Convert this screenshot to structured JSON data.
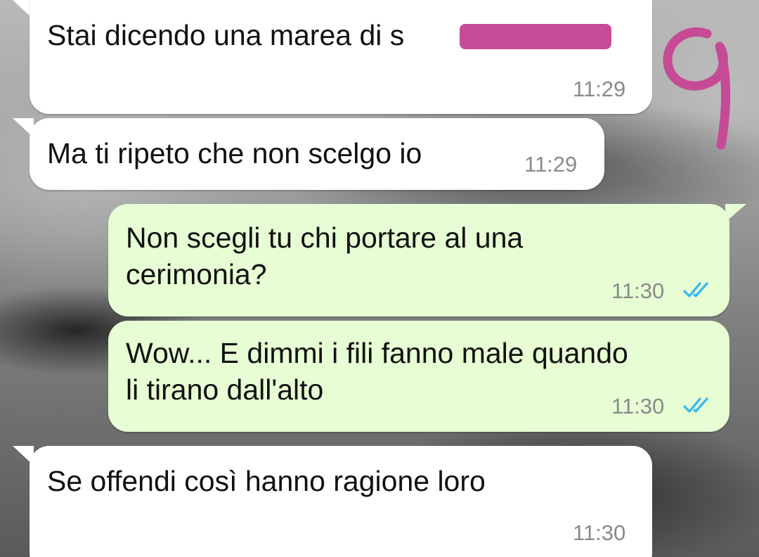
{
  "chat": {
    "messages": [
      {
        "direction": "incoming",
        "text": "Stai dicendo una marea di s",
        "time": "11:29",
        "redacted": true
      },
      {
        "direction": "incoming",
        "text": "Ma ti ripeto che non scelgo io",
        "time": "11:29"
      },
      {
        "direction": "outgoing",
        "text": "Non scegli tu chi portare al una\ncerimonia?",
        "time": "11:30",
        "status": "read"
      },
      {
        "direction": "outgoing",
        "text": "Wow... E dimmi i fili fanno male quando\nli tirano dall'alto",
        "time": "11:30",
        "status": "read"
      },
      {
        "direction": "incoming",
        "text": "Se offendi così hanno ragione loro",
        "time": "11:30"
      }
    ]
  },
  "colors": {
    "incoming_bubble": "#ffffff",
    "outgoing_bubble": "#e7fdd3",
    "read_ticks": "#34b7f1",
    "redaction": "#c74a96",
    "annotation": "#c74a96"
  },
  "icons": {
    "read_status": "double-check-icon",
    "annotation": "handwritten-nine-scribble"
  }
}
